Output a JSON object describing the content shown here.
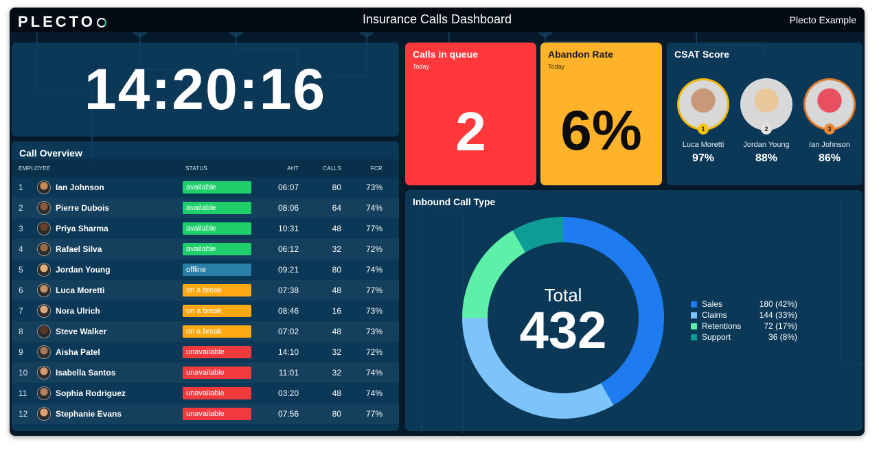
{
  "header": {
    "logo_text": "PLECTO",
    "title": "Insurance Calls Dashboard",
    "org_name": "Plecto Example"
  },
  "clock": {
    "time": "14:20:16"
  },
  "call_overview": {
    "title": "Call Overview",
    "columns": {
      "employee": "EMPLOYEE",
      "status": "STATUS",
      "aht": "AHT",
      "calls": "CALLS",
      "fcr": "FCR"
    },
    "rows": [
      {
        "rank": "1",
        "name": "Ian Johnson",
        "status": "available",
        "aht": "06:07",
        "calls": "80",
        "fcr": "73%"
      },
      {
        "rank": "2",
        "name": "Pierre Dubois",
        "status": "available",
        "aht": "08:06",
        "calls": "64",
        "fcr": "74%"
      },
      {
        "rank": "3",
        "name": "Priya Sharma",
        "status": "available",
        "aht": "10:31",
        "calls": "48",
        "fcr": "77%"
      },
      {
        "rank": "4",
        "name": "Rafael Silva",
        "status": "available",
        "aht": "06:12",
        "calls": "32",
        "fcr": "72%"
      },
      {
        "rank": "5",
        "name": "Jordan Young",
        "status": "offline",
        "aht": "09:21",
        "calls": "80",
        "fcr": "74%"
      },
      {
        "rank": "6",
        "name": "Luca Moretti",
        "status": "on a break",
        "aht": "07:38",
        "calls": "48",
        "fcr": "77%"
      },
      {
        "rank": "7",
        "name": "Nora Ulrich",
        "status": "on a break",
        "aht": "08:46",
        "calls": "16",
        "fcr": "73%"
      },
      {
        "rank": "8",
        "name": "Steve Walker",
        "status": "on a break",
        "aht": "07:02",
        "calls": "48",
        "fcr": "73%"
      },
      {
        "rank": "9",
        "name": "Aisha Patel",
        "status": "unavailable",
        "aht": "14:10",
        "calls": "32",
        "fcr": "72%"
      },
      {
        "rank": "10",
        "name": "Isabella Santos",
        "status": "unavailable",
        "aht": "11:01",
        "calls": "32",
        "fcr": "74%"
      },
      {
        "rank": "11",
        "name": "Sophia Rodriguez",
        "status": "unavailable",
        "aht": "03:20",
        "calls": "48",
        "fcr": "74%"
      },
      {
        "rank": "12",
        "name": "Stephanie Evans",
        "status": "unavailable",
        "aht": "07:56",
        "calls": "80",
        "fcr": "77%"
      }
    ],
    "status_colors": {
      "available": "#1fcf6c",
      "offline": "#2a7fa8",
      "on a break": "#ffa812",
      "unavailable": "#f03a3e"
    }
  },
  "calls_in_queue": {
    "title": "Calls in queue",
    "period": "Today",
    "value": "2",
    "color": "#ff393b"
  },
  "abandon_rate": {
    "title": "Abandon Rate",
    "period": "Today",
    "value": "6%",
    "color": "#ffb32a"
  },
  "csat": {
    "title": "CSAT Score",
    "people": [
      {
        "name": "Luca Moretti",
        "score": "97%",
        "place": "1",
        "ring_color": "#f2b705",
        "badge_color": "#f5c518"
      },
      {
        "name": "Jordan Young",
        "score": "88%",
        "place": "2",
        "ring_color": "#d9d9d9",
        "badge_color": "#e2e2e2"
      },
      {
        "name": "Ian Johnson",
        "score": "86%",
        "place": "3",
        "ring_color": "#e07a2c",
        "badge_color": "#e8893a"
      }
    ]
  },
  "inbound_call_type": {
    "title": "Inbound Call Type",
    "total_label": "Total",
    "total_value": "432",
    "legend": [
      {
        "label": "Sales",
        "value_text": "180 (42%)",
        "color": "#1e7cf0"
      },
      {
        "label": "Claims",
        "value_text": "144 (33%)",
        "color": "#7cc4fb"
      },
      {
        "label": "Retentions",
        "value_text": "72 (17%)",
        "color": "#5ef0a8"
      },
      {
        "label": "Support",
        "value_text": "36 (8%)",
        "color": "#0e9c96"
      }
    ]
  },
  "chart_data": {
    "type": "pie",
    "title": "Inbound Call Type",
    "categories": [
      "Sales",
      "Claims",
      "Retentions",
      "Support"
    ],
    "values": [
      180,
      144,
      72,
      36
    ],
    "colors": [
      "#1e7cf0",
      "#7cc4fb",
      "#5ef0a8",
      "#0e9c96"
    ],
    "center_label": "Total",
    "center_value": 432,
    "legend_position": "right"
  }
}
